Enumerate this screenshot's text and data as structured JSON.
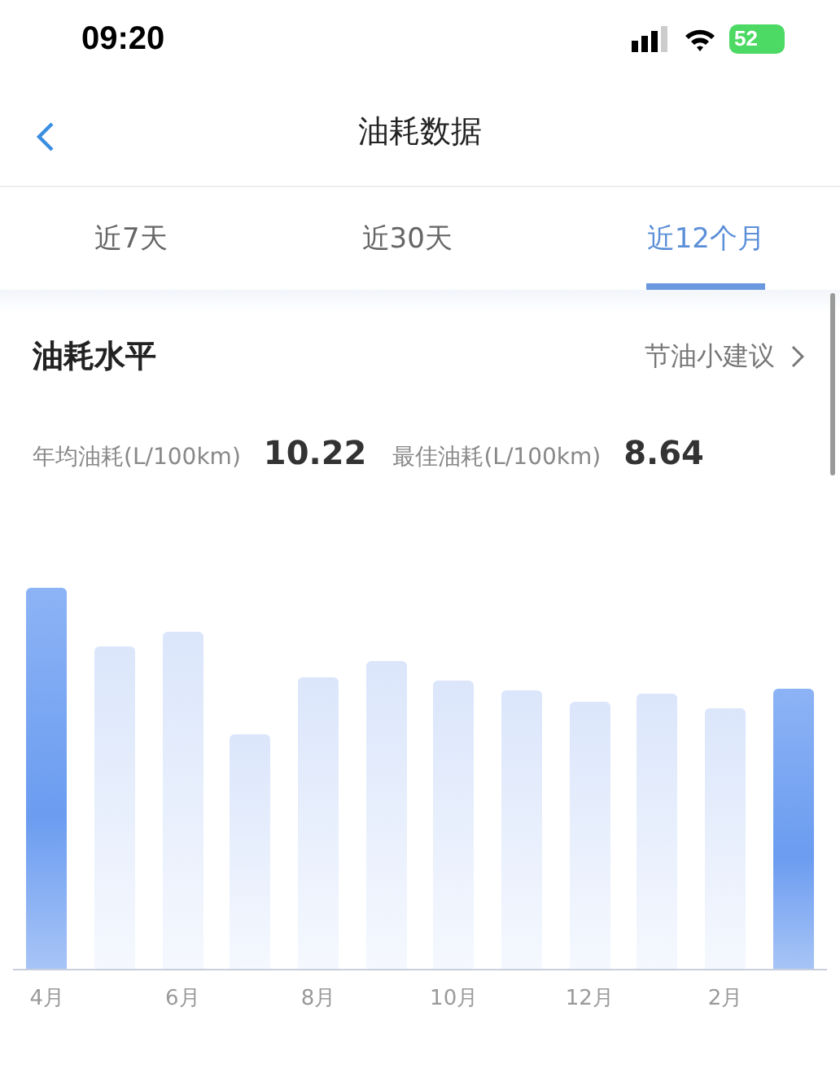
{
  "status_bar": {
    "time": "09:20",
    "battery": "52"
  },
  "nav": {
    "title": "油耗数据"
  },
  "tabs": [
    {
      "label": "近7天",
      "selected": false
    },
    {
      "label": "近30天",
      "selected": false
    },
    {
      "label": "近12个月",
      "selected": true
    }
  ],
  "section": {
    "title": "油耗水平",
    "link": "节油小建议"
  },
  "stats": [
    {
      "label": "年均油耗(L/100km)",
      "value": "10.22"
    },
    {
      "label": "最佳油耗(L/100km)",
      "value": "8.64"
    }
  ],
  "bars": [
    {
      "selected": true
    },
    {
      "selected": false
    },
    {
      "selected": false
    },
    {
      "selected": false
    },
    {
      "selected": false
    },
    {
      "selected": false
    },
    {
      "selected": false
    },
    {
      "selected": false
    },
    {
      "selected": false
    },
    {
      "selected": false
    },
    {
      "selected": false
    },
    {
      "selected": true
    }
  ],
  "x_labels": [
    "4月",
    "6月",
    "8月",
    "10月",
    "12月",
    "2月"
  ]
}
